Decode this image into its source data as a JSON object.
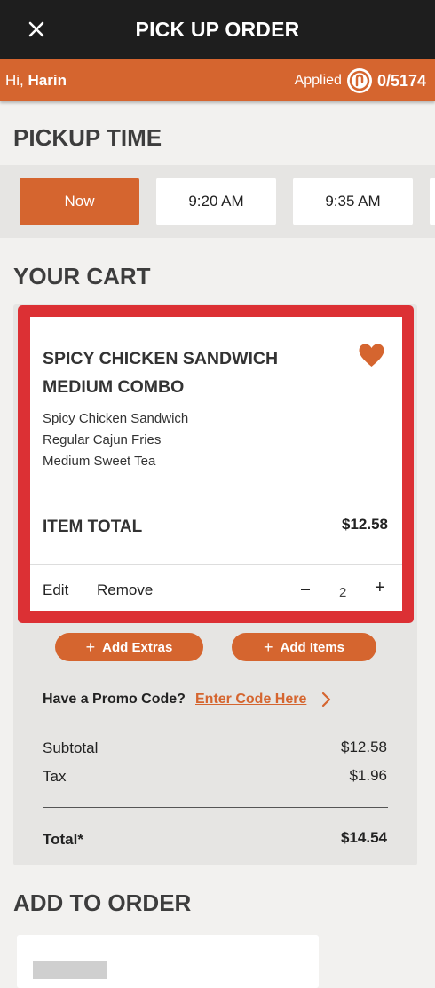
{
  "header": {
    "title": "PICK UP ORDER",
    "close_icon": "close-icon"
  },
  "userbar": {
    "greeting": "Hi,",
    "name": "Harin",
    "applied_label": "Applied",
    "points": "0/5174",
    "points_icon": "rewards-icon"
  },
  "pickup": {
    "title": "PICKUP TIME",
    "times": [
      "Now",
      "9:20 AM",
      "9:35 AM"
    ],
    "selected": "Now"
  },
  "cart": {
    "title": "YOUR CART",
    "item": {
      "name": "SPICY CHICKEN SANDWICH MEDIUM COMBO",
      "components": [
        "Spicy Chicken Sandwich",
        "Regular Cajun Fries",
        "Medium Sweet Tea"
      ],
      "total_label": "ITEM TOTAL",
      "total_value": "$12.58",
      "edit_label": "Edit",
      "remove_label": "Remove",
      "minus_label": "–",
      "plus_label": "+",
      "quantity": "2",
      "favorite_icon": "heart-icon"
    },
    "add_extras_label": "Add Extras",
    "add_items_label": "Add Items",
    "promo": {
      "label": "Have a Promo Code?",
      "link": "Enter Code Here"
    },
    "summary": {
      "subtotal_label": "Subtotal",
      "subtotal_value": "$12.58",
      "tax_label": "Tax",
      "tax_value": "$1.96",
      "total_label": "Total*",
      "total_value": "$14.54"
    }
  },
  "add_to_order": {
    "title": "ADD TO ORDER"
  },
  "colors": {
    "accent": "#d5652f",
    "header_bg": "#1e1e1e",
    "highlight_border": "#dc3034"
  }
}
